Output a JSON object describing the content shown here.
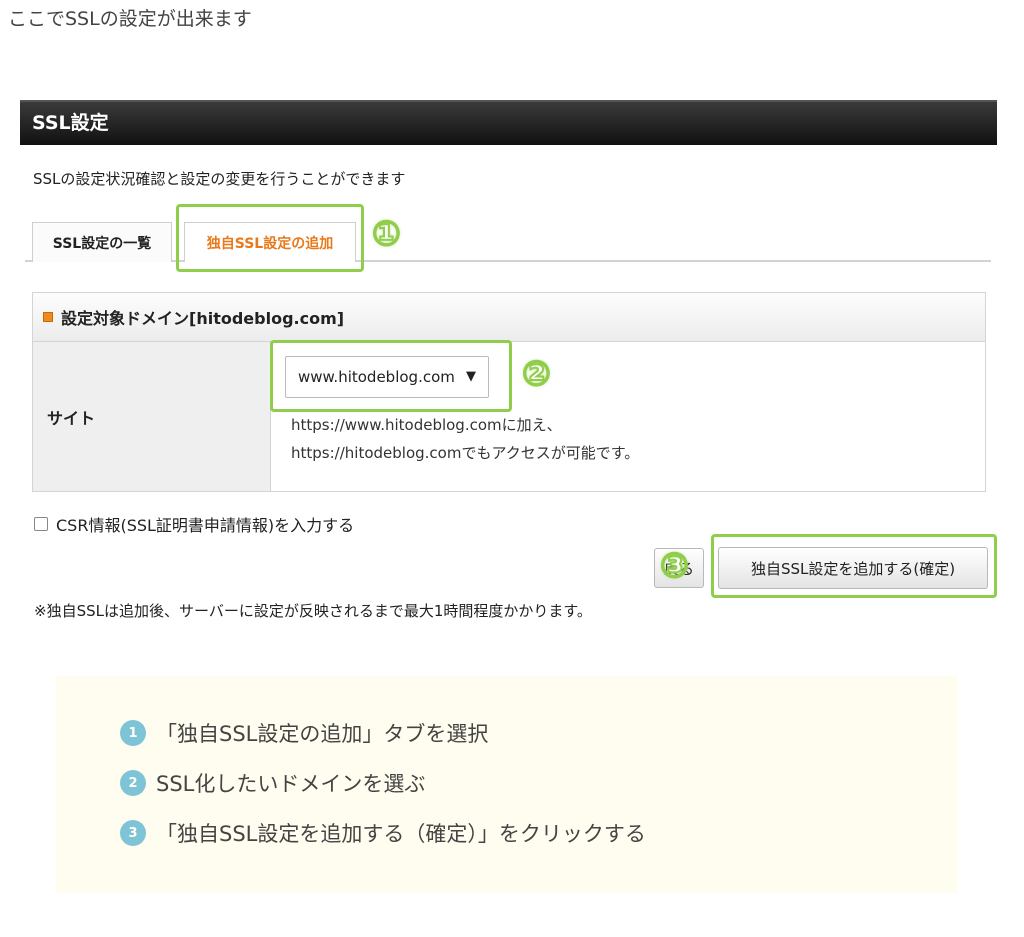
{
  "intro": "ここでSSLの設定が出来ます",
  "panel": {
    "title": "SSL設定",
    "description": "SSLの設定状況確認と設定の変更を行うことができます"
  },
  "tabs": [
    {
      "label": "SSL設定の一覧",
      "active": false
    },
    {
      "label": "独自SSL設定の追加",
      "active": true
    }
  ],
  "callouts": [
    "①",
    "②",
    "③"
  ],
  "domain_section": {
    "heading": "設定対象ドメイン[hitodeblog.com]",
    "site_label": "サイト",
    "site_select_value": "www.hitodeblog.com",
    "hint_line1": "https://www.hitodeblog.comに加え、",
    "hint_line2": "https://hitodeblog.comでもアクセスが可能です。"
  },
  "csr_checkbox_label": "CSR情報(SSL証明書申請情報)を入力する",
  "buttons": {
    "back_label": "戻る",
    "confirm_label": "独自SSL設定を追加する(確定)"
  },
  "note": "※独自SSLは追加後、サーバーに設定が反映されるまで最大1時間程度かかります。",
  "steps": [
    {
      "number": "1",
      "text": "「独自SSL設定の追加」タブを選択"
    },
    {
      "number": "2",
      "text": "SSL化したいドメインを選ぶ"
    },
    {
      "number": "3",
      "text": "「独自SSL設定を追加する（確定）」をクリックする"
    }
  ],
  "colors": {
    "highlight": "#8fcd4a",
    "active_tab_text": "#e8781a",
    "step_circle": "#7fc4d6",
    "summary_bg": "#fffdef"
  }
}
